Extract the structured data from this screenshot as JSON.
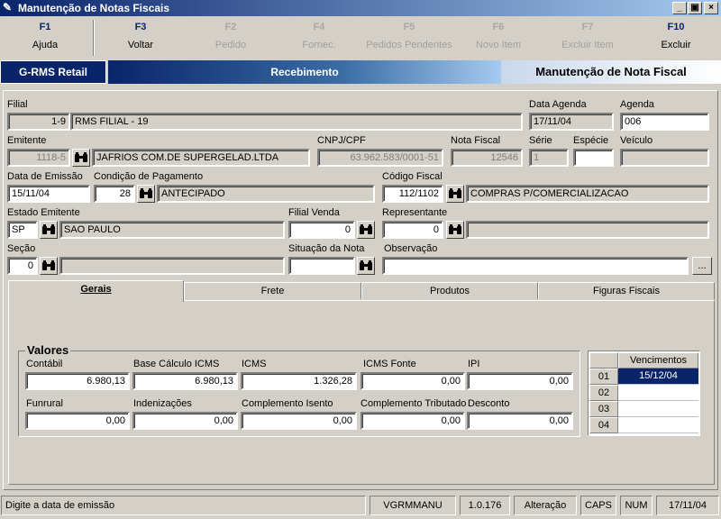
{
  "window": {
    "title": "Manutenção de Notas Fiscais"
  },
  "toolbar": [
    {
      "key": "F1",
      "label": "Ajuda",
      "enabled": true
    },
    {
      "key": "F3",
      "label": "Voltar",
      "enabled": true
    },
    {
      "key": "F2",
      "label": "Pedido",
      "enabled": false
    },
    {
      "key": "F4",
      "label": "Fornec.",
      "enabled": false
    },
    {
      "key": "F5",
      "label": "Pedidos Pendentes",
      "enabled": false
    },
    {
      "key": "F6",
      "label": "Novo Item",
      "enabled": false
    },
    {
      "key": "F7",
      "label": "Excluir Item",
      "enabled": false
    },
    {
      "key": "F10",
      "label": "Excluir",
      "enabled": true
    }
  ],
  "band": {
    "app": "G-RMS Retail",
    "module": "Recebimento",
    "screen": "Manutenção de Nota Fiscal"
  },
  "form": {
    "filial": {
      "label": "Filial",
      "code": "1-9",
      "name": "RMS FILIAL - 19"
    },
    "data_agenda": {
      "label": "Data Agenda",
      "value": "17/11/04"
    },
    "agenda": {
      "label": "Agenda",
      "value": "006"
    },
    "emitente": {
      "label": "Emitente",
      "code": "1118-5",
      "name": "JAFRIOS COM.DE SUPERGELAD.LTDA"
    },
    "cnpj": {
      "label": "CNPJ/CPF",
      "value": "63.962.583/0001-51"
    },
    "nota_fiscal": {
      "label": "Nota Fiscal",
      "value": "12546"
    },
    "serie": {
      "label": "Série",
      "value": "1"
    },
    "especie": {
      "label": "Espécie",
      "value": ""
    },
    "veiculo": {
      "label": "Veículo",
      "value": ""
    },
    "data_emissao": {
      "label": "Data de Emissão",
      "value": "15/11/04"
    },
    "cond_pagamento": {
      "label": "Condição de Pagamento",
      "code": "28",
      "name": "ANTECIPADO"
    },
    "codigo_fiscal": {
      "label": "Código Fiscal",
      "code": "112/1102",
      "name": "COMPRAS P/COMERCIALIZACAO"
    },
    "estado_emitente": {
      "label": "Estado Emitente",
      "code": "SP",
      "name": "SAO PAULO"
    },
    "filial_venda": {
      "label": "Filial Venda",
      "value": "0"
    },
    "representante": {
      "label": "Representante",
      "code": "0",
      "name": ""
    },
    "secao": {
      "label": "Seção",
      "code": "0",
      "name": ""
    },
    "situacao_nota": {
      "label": "Situação da Nota",
      "value": ""
    },
    "observacao": {
      "label": "Observação",
      "value": "",
      "button": "..."
    }
  },
  "tabs": [
    {
      "label": "Gerais",
      "active": true
    },
    {
      "label": "Frete",
      "active": false
    },
    {
      "label": "Produtos",
      "active": false
    },
    {
      "label": "Figuras Fiscais",
      "active": false
    }
  ],
  "valores": {
    "title": "Valores",
    "contabil": {
      "label": "Contábil",
      "value": "6.980,13"
    },
    "base_icms": {
      "label": "Base Cálculo ICMS",
      "value": "6.980,13"
    },
    "icms": {
      "label": "ICMS",
      "value": "1.326,28"
    },
    "icms_fonte": {
      "label": "ICMS Fonte",
      "value": "0,00"
    },
    "ipi": {
      "label": "IPI",
      "value": "0,00"
    },
    "funrural": {
      "label": "Funrural",
      "value": "0,00"
    },
    "indenizacoes": {
      "label": "Indenizações",
      "value": "0,00"
    },
    "comp_isento": {
      "label": "Complemento Isento",
      "value": "0,00"
    },
    "comp_tributado": {
      "label": "Complemento Tributado",
      "value": "0,00"
    },
    "desconto": {
      "label": "Desconto",
      "value": "0,00"
    }
  },
  "vencimentos": {
    "header": "Vencimentos",
    "rows": [
      {
        "n": "01",
        "date": "15/12/04"
      },
      {
        "n": "02",
        "date": ""
      },
      {
        "n": "03",
        "date": ""
      },
      {
        "n": "04",
        "date": ""
      }
    ]
  },
  "status": {
    "message": "Digite a data de emissão",
    "program": "VGRMMANU",
    "version": "1.0.176",
    "mode": "Alteração",
    "caps": "CAPS",
    "num": "NUM",
    "date": "17/11/04"
  },
  "colors": {
    "titlebar": "#0a246a",
    "selection": "#0a246a",
    "face": "#d4d0c8"
  },
  "icons": {
    "search": "binoculars-icon",
    "window": "pencil-icon"
  }
}
